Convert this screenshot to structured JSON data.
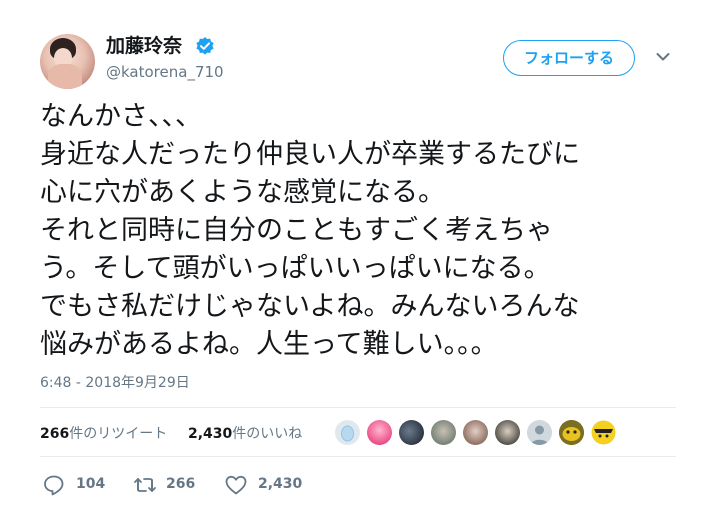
{
  "user": {
    "name": "加藤玲奈",
    "handle": "@katorena_710",
    "verified": true
  },
  "follow_button": {
    "label": "フォローする"
  },
  "tweet": {
    "lines": [
      "なんかさ、、、",
      "身近な人だったり仲良い人が卒業するたびに",
      "心に穴があくような感覚になる。",
      "それと同時に自分のこともすごく考えちゃ",
      "う。そして頭がいっぱいいっぱいになる。",
      "でもさ私だけじゃないよね。みんないろんな",
      "悩みがあるよね。人生って難しい。。。"
    ],
    "timestamp": "6:48 - 2018年9月29日"
  },
  "stats": {
    "retweets_count": "266",
    "retweets_label": "件のリツイート",
    "likes_count": "2,430",
    "likes_label": "件のいいね"
  },
  "liker_avatars": [
    "default-egg",
    "pink-hair",
    "group-photo",
    "portrait",
    "portrait",
    "portrait",
    "default-person",
    "cartoon-yellow",
    "cartoon-yellow-black"
  ],
  "actions": {
    "reply_count": "104",
    "retweet_count": "266",
    "like_count": "2,430"
  },
  "colors": {
    "accent": "#1da1f2",
    "secondary_text": "#657786",
    "primary_text": "#14171a",
    "divider": "#e6ecf0"
  }
}
